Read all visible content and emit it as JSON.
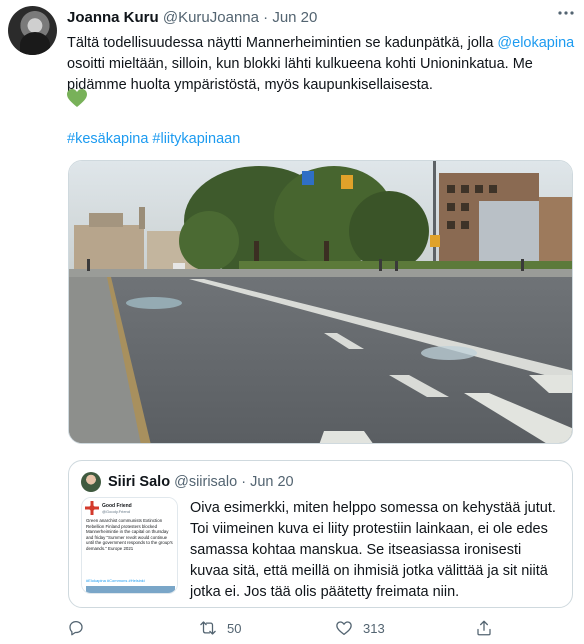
{
  "tweet": {
    "author_name": "Joanna Kuru",
    "author_handle": "@KuruJoanna",
    "separator": "·",
    "date": "Jun 20",
    "text_part1": "Tältä todellisuudessa näytti Mannerheimintien se kadunpätkä, jolla",
    "mention": "@elokapina",
    "text_part2": "osoitti mieltään, silloin, kun blokki lähti kulkueena kohti Unioninkatua. Me pidämme huolta ympäristöstä, myös kaupunkisellaisesta.",
    "emoji_icon": "green-heart-icon",
    "hashtags": [
      "#kesäkapina",
      "#liitykapinaan"
    ]
  },
  "quote": {
    "author_name": "Siiri Salo",
    "author_handle": "@siirisalo",
    "separator": "·",
    "date": "Jun 20",
    "text": "Oiva esimerkki, miten helppo somessa on kehystää jutut. Toi viimeinen kuva ei liity protestiin lainkaan, ei ole edes samassa kohtaa manskua. Se itseasiassa ironisesti kuvaa sitä, että meillä on ihmisiä jotka välittää ja sit niitä jotka ei. Jos tää olis päätetty freimata niin.",
    "thumb": {
      "source_name": "Good Friend",
      "source_handle": "@Goody.Friend",
      "body": "Green anarchist communists Extinction Rebellion Finland protesters blocked Mannerheimintie in the capital on thursday and friday \"Summer revolt would continue until the government responds to the group's demands.\" Europe 2021",
      "tags": "#Elokapina #Commons #Helsinki"
    }
  },
  "actions": {
    "reply_icon": "reply-icon",
    "retweet_icon": "retweet-icon",
    "retweet_count": "50",
    "like_icon": "heart-icon",
    "like_count": "313",
    "share_icon": "share-icon"
  },
  "colors": {
    "link": "#1d9bf0",
    "secondary_text": "#536471",
    "border": "#cfd9de",
    "heart": "#78b159"
  }
}
